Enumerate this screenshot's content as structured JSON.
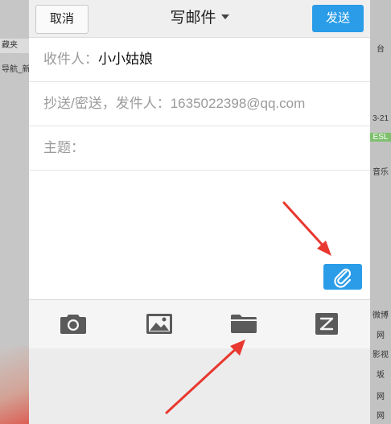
{
  "header": {
    "cancel_label": "取消",
    "title": "写邮件",
    "send_label": "发送"
  },
  "fields": {
    "to_label": "收件人：",
    "to_value": "小小姑娘",
    "cc_label": "抄送/密送，发件人：1635022398@qq.com",
    "subject_label": "主题："
  },
  "background": {
    "left_row1": "藏夹",
    "left_row2": "导航_新",
    "right_rows": [
      "台",
      "3-21",
      "ESL",
      "音乐",
      "微博",
      "网",
      "影视",
      "坂",
      "网",
      "网"
    ]
  },
  "colors": {
    "accent": "#2a9ce8",
    "annotation_arrow": "#e8382f"
  },
  "icons": {
    "attach": "paperclip-icon",
    "tools": [
      "camera-icon",
      "image-icon",
      "folder-icon",
      "edit-icon"
    ]
  }
}
